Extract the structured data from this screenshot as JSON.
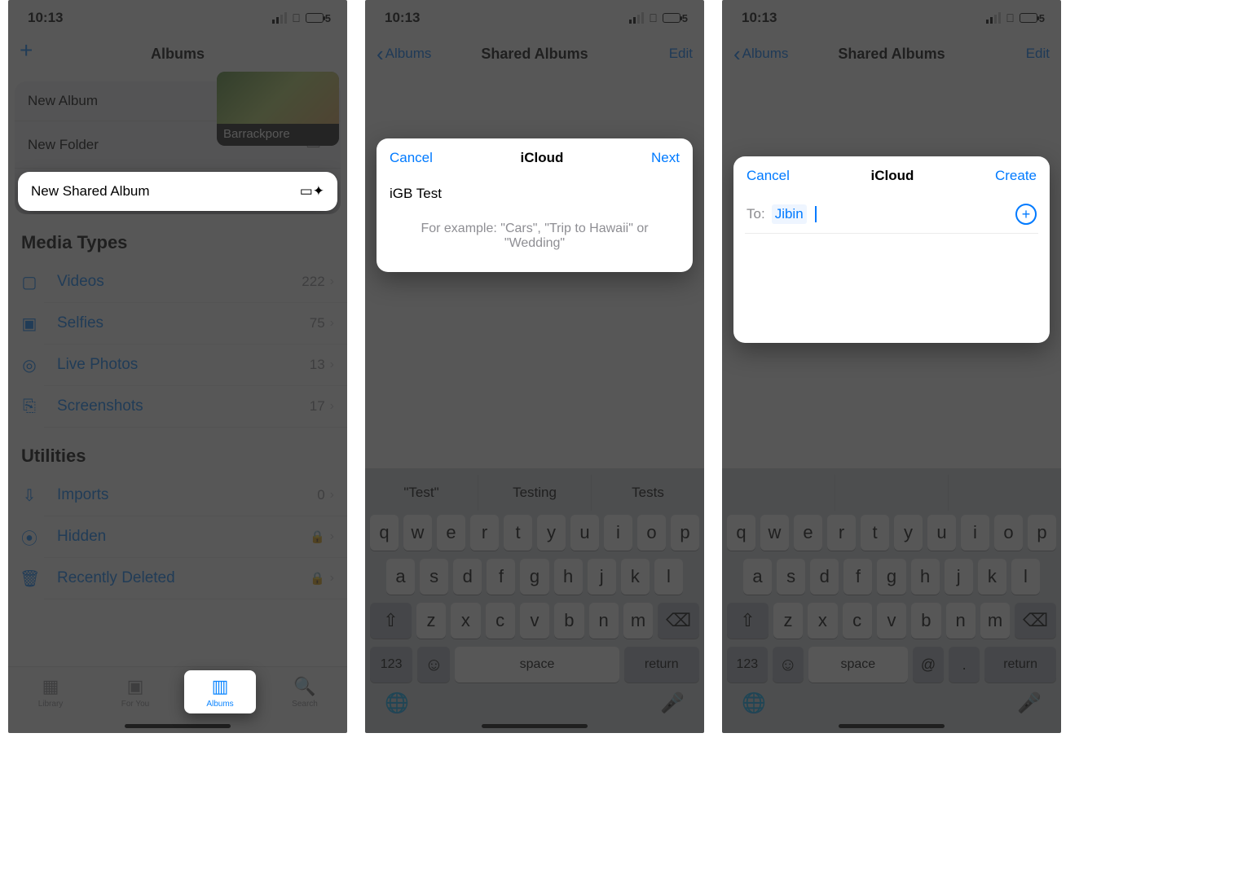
{
  "status": {
    "time": "10:13",
    "battery": "5"
  },
  "screen1": {
    "nav_title": "Albums",
    "album_caption": "Barrackpore",
    "menu": {
      "new_album": "New Album",
      "new_folder": "New Folder",
      "new_shared": "New Shared Album"
    },
    "section_media": "Media Types",
    "rows_media": [
      {
        "title": "Videos",
        "count": "222"
      },
      {
        "title": "Selfies",
        "count": "75"
      },
      {
        "title": "Live Photos",
        "count": "13"
      },
      {
        "title": "Screenshots",
        "count": "17"
      }
    ],
    "section_util": "Utilities",
    "rows_util": [
      {
        "title": "Imports",
        "count": "0"
      },
      {
        "title": "Hidden"
      },
      {
        "title": "Recently Deleted"
      }
    ],
    "tabs": {
      "library": "Library",
      "foryou": "For You",
      "albums": "Albums",
      "search": "Search"
    }
  },
  "screen2": {
    "nav_back": "Albums",
    "nav_title": "Shared Albums",
    "nav_edit": "Edit",
    "modal": {
      "cancel": "Cancel",
      "title": "iCloud",
      "next": "Next",
      "name_value": "iGB Test",
      "hint": "For example: \"Cars\", \"Trip to Hawaii\" or \"Wedding\""
    },
    "predict": [
      "\"Test\"",
      "Testing",
      "Tests"
    ]
  },
  "screen3": {
    "nav_back": "Albums",
    "nav_title": "Shared Albums",
    "nav_edit": "Edit",
    "modal": {
      "cancel": "Cancel",
      "title": "iCloud",
      "create": "Create",
      "to_label": "To:",
      "to_value": "Jibin"
    }
  },
  "kb": {
    "row1": [
      "q",
      "w",
      "e",
      "r",
      "t",
      "y",
      "u",
      "i",
      "o",
      "p"
    ],
    "row2": [
      "a",
      "s",
      "d",
      "f",
      "g",
      "h",
      "j",
      "k",
      "l"
    ],
    "row3": [
      "z",
      "x",
      "c",
      "v",
      "b",
      "n",
      "m"
    ],
    "num": "123",
    "space": "space",
    "return": "return",
    "at": "@",
    "dot": "."
  }
}
